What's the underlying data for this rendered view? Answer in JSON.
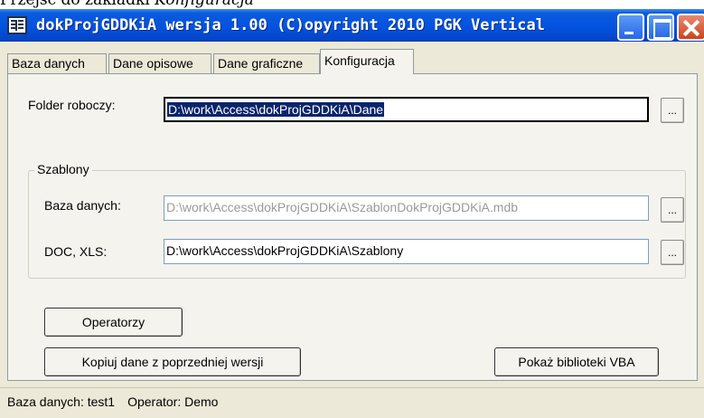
{
  "doc_text": {
    "prefix": "Przejść do zakładki ",
    "italic": "Konfiguracja"
  },
  "window": {
    "title": "dokProjGDDKiA wersja 1.00   (C)opyright 2010 PGK Vertical"
  },
  "tabs": [
    {
      "label": "Baza danych"
    },
    {
      "label": "Dane opisowe"
    },
    {
      "label": "Dane graficzne"
    },
    {
      "label": "Konfiguracja",
      "active": true
    }
  ],
  "config": {
    "working_folder_label": "Folder roboczy:",
    "working_folder_value": "D:\\work\\Access\\dokProjGDDKiA\\Dane",
    "browse_label": "...",
    "templates_group_label": "Szablony",
    "db_label": "Baza danych:",
    "db_value": "D:\\work\\Access\\dokProjGDDKiA\\SzablonDokProjGDDKiA.mdb",
    "docxls_label": "DOC, XLS:",
    "docxls_value": "D:\\work\\Access\\dokProjGDDKiA\\Szablony"
  },
  "buttons": {
    "operators": "Operatorzy",
    "copy_data": "Kopiuj dane z poprzedniej wersji",
    "vba_libs": "Pokaż biblioteki VBA"
  },
  "statusbar": {
    "database": "Baza danych: test1",
    "operator": "Operator: Demo"
  },
  "colors": {
    "titlebar": "#0454e0",
    "selection": "#0a246a",
    "panel": "#f4f3ee"
  }
}
